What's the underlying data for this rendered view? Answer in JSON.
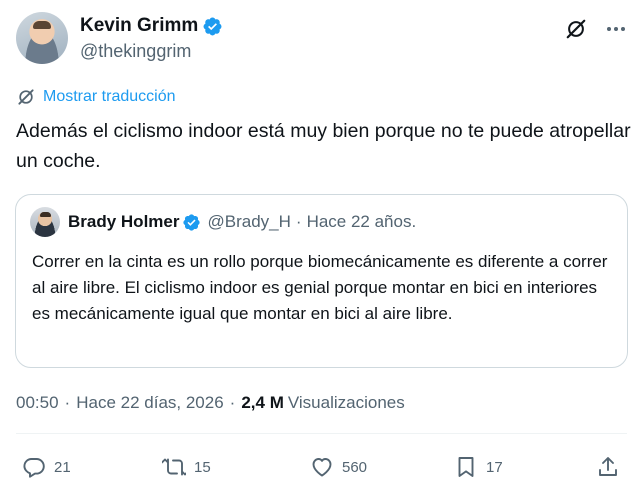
{
  "author": {
    "display_name": "Kevin Grimm",
    "handle": "@thekinggrim",
    "verified": true
  },
  "translate_label": "Mostrar traducción",
  "tweet_text": "Además el ciclismo indoor está muy bien porque no te puede atropellar un coche.",
  "quote": {
    "display_name": "Brady Holmer",
    "handle": "@Brady_H",
    "separator": "·",
    "time": "Hace 22 años.",
    "text": "Correr en la cinta es un rollo porque biomecánicamente es diferente a correr al aire libre. El ciclismo indoor es genial porque montar en bici en interiores es mecánicamente igual que montar en bici al aire libre."
  },
  "meta": {
    "time": "00:50",
    "sep1": "·",
    "date": "Hace 22 días, 2026",
    "sep2": "·",
    "views_count": "2,4 M",
    "views_label": "Visualizaciones"
  },
  "actions": {
    "replies": "21",
    "reposts": "15",
    "likes": "560",
    "bookmarks": "17"
  },
  "colors": {
    "accent": "#1d9bf0",
    "text": "#0f1419",
    "muted": "#536471",
    "border": "#cfd9de"
  }
}
